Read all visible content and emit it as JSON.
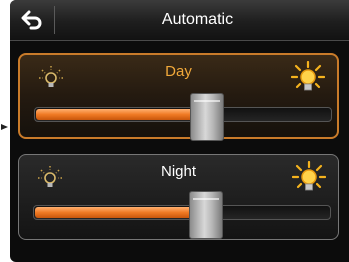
{
  "header": {
    "title": "Automatic",
    "back_icon": "back-arrow-icon"
  },
  "panels": {
    "day": {
      "label": "Day",
      "level": 0.58,
      "accent_color": "#f0a83a",
      "min_icon": "dim-bulb-icon",
      "max_icon": "bright-bulb-icon"
    },
    "night": {
      "label": "Night",
      "level": 0.58,
      "accent_color": "#ffffff",
      "min_icon": "dim-bulb-icon",
      "max_icon": "bright-bulb-icon"
    }
  },
  "colors": {
    "slider_fill": "#f07a24",
    "selected_border": "#c97b2a",
    "bulb_glow": "#f0a83a"
  }
}
